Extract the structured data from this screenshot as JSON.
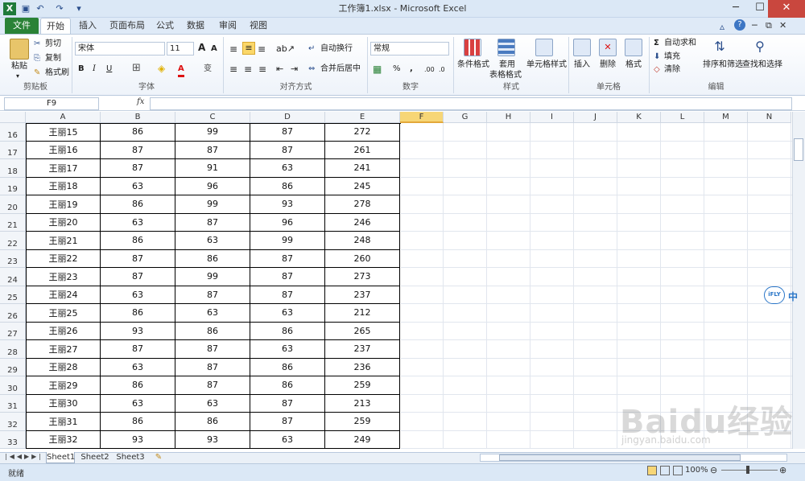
{
  "window": {
    "title": "工作簿1.xlsx - Microsoft Excel"
  },
  "tabs": [
    "文件",
    "开始",
    "插入",
    "页面布局",
    "公式",
    "数据",
    "审阅",
    "视图"
  ],
  "ribbon": {
    "clipboard": {
      "paste": "粘贴",
      "cut": "剪切",
      "copy": "复制",
      "format_painter": "格式刷",
      "label": "剪贴板"
    },
    "font": {
      "name": "宋体",
      "size": "11",
      "bold": "B",
      "italic": "I",
      "underline": "U",
      "label": "字体",
      "grow": "A",
      "shrink": "A",
      "color_letter": "A",
      "phonetic": "变"
    },
    "alignment": {
      "wrap": "自动换行",
      "merge": "合并后居中",
      "label": "对齐方式"
    },
    "number": {
      "format": "常规",
      "percent": "%",
      "comma": ",",
      "label": "数字"
    },
    "styles": {
      "conditional": "条件格式",
      "table1": "套用",
      "table2": "表格格式",
      "cell_styles": "单元格样式",
      "label": "样式"
    },
    "cells": {
      "insert": "插入",
      "delete": "删除",
      "format": "格式",
      "label": "单元格"
    },
    "editing": {
      "autosum": "自动求和",
      "fill": "填充",
      "clear": "清除",
      "sort": "排序和筛选",
      "find": "查找和选择",
      "label": "编辑"
    }
  },
  "formula_bar": {
    "name_box": "F9",
    "fx": "fx",
    "content": ""
  },
  "columns": [
    "A",
    "B",
    "C",
    "D",
    "E",
    "F",
    "G",
    "H",
    "I",
    "J",
    "K",
    "L",
    "M",
    "N"
  ],
  "selected_column": "F",
  "rows": [
    {
      "num": "16",
      "name": "王丽15",
      "b": "86",
      "c": "99",
      "d": "87",
      "e": "272"
    },
    {
      "num": "17",
      "name": "王丽16",
      "b": "87",
      "c": "87",
      "d": "87",
      "e": "261"
    },
    {
      "num": "18",
      "name": "王丽17",
      "b": "87",
      "c": "91",
      "d": "63",
      "e": "241"
    },
    {
      "num": "19",
      "name": "王丽18",
      "b": "63",
      "c": "96",
      "d": "86",
      "e": "245"
    },
    {
      "num": "20",
      "name": "王丽19",
      "b": "86",
      "c": "99",
      "d": "93",
      "e": "278"
    },
    {
      "num": "21",
      "name": "王丽20",
      "b": "63",
      "c": "87",
      "d": "96",
      "e": "246"
    },
    {
      "num": "22",
      "name": "王丽21",
      "b": "86",
      "c": "63",
      "d": "99",
      "e": "248"
    },
    {
      "num": "23",
      "name": "王丽22",
      "b": "87",
      "c": "86",
      "d": "87",
      "e": "260"
    },
    {
      "num": "24",
      "name": "王丽23",
      "b": "87",
      "c": "99",
      "d": "87",
      "e": "273"
    },
    {
      "num": "25",
      "name": "王丽24",
      "b": "63",
      "c": "87",
      "d": "87",
      "e": "237"
    },
    {
      "num": "26",
      "name": "王丽25",
      "b": "86",
      "c": "63",
      "d": "63",
      "e": "212"
    },
    {
      "num": "27",
      "name": "王丽26",
      "b": "93",
      "c": "86",
      "d": "86",
      "e": "265"
    },
    {
      "num": "28",
      "name": "王丽27",
      "b": "87",
      "c": "87",
      "d": "63",
      "e": "237"
    },
    {
      "num": "29",
      "name": "王丽28",
      "b": "63",
      "c": "87",
      "d": "86",
      "e": "236"
    },
    {
      "num": "30",
      "name": "王丽29",
      "b": "86",
      "c": "87",
      "d": "86",
      "e": "259"
    },
    {
      "num": "31",
      "name": "王丽30",
      "b": "63",
      "c": "63",
      "d": "87",
      "e": "213"
    },
    {
      "num": "32",
      "name": "王丽31",
      "b": "86",
      "c": "86",
      "d": "87",
      "e": "259"
    },
    {
      "num": "33",
      "name": "王丽32",
      "b": "93",
      "c": "93",
      "d": "63",
      "e": "249"
    }
  ],
  "sheets": [
    "Sheet1",
    "Sheet2",
    "Sheet3"
  ],
  "active_sheet": "Sheet1",
  "status": {
    "mode": "就绪",
    "zoom": "100%"
  },
  "ime_badge": {
    "logo": "iFLY",
    "text": "中"
  },
  "watermark": {
    "text": "Baidu经验",
    "url": "jingyan.baidu.com"
  },
  "colors": {
    "file_tab": "#2a8236",
    "selected_col": "#f7d676",
    "close_btn": "#c9473e"
  }
}
